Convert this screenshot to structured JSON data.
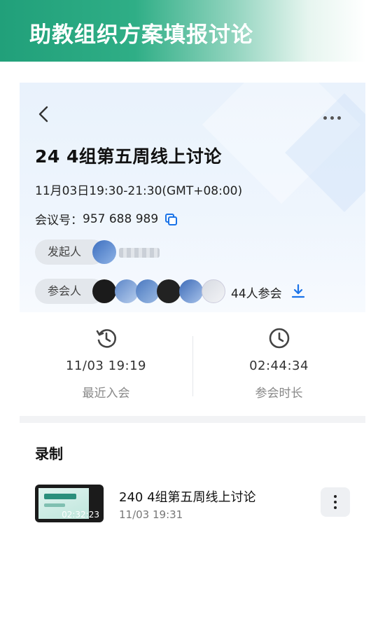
{
  "banner": {
    "title": "助教组织方案填报讨论"
  },
  "meeting": {
    "title": "24   4组第五周线上讨论",
    "time": "11月03日19:30-21:30(GMT+08:00)",
    "id_label": "会议号：",
    "id_value": "957 688 989"
  },
  "people": {
    "initiator_label": "发起人",
    "participants_label": "参会人",
    "attendee_count": "44人参会"
  },
  "stats": {
    "last_join_value": "11/03 19:19",
    "last_join_label": "最近入会",
    "duration_value": "02:44:34",
    "duration_label": "参会时长"
  },
  "recording": {
    "section_title": "录制",
    "items": [
      {
        "title": "240   4组第五周线上讨论",
        "date": "11/03 19:31",
        "duration": "02:32:23"
      }
    ]
  },
  "colors": {
    "brand_green": "#21a07a",
    "link_blue": "#1a73e8"
  },
  "icons": {
    "back": "back-arrow-icon",
    "more": "more-dots-icon",
    "copy": "copy-icon",
    "download": "download-icon",
    "history": "history-icon",
    "clock": "clock-icon"
  }
}
